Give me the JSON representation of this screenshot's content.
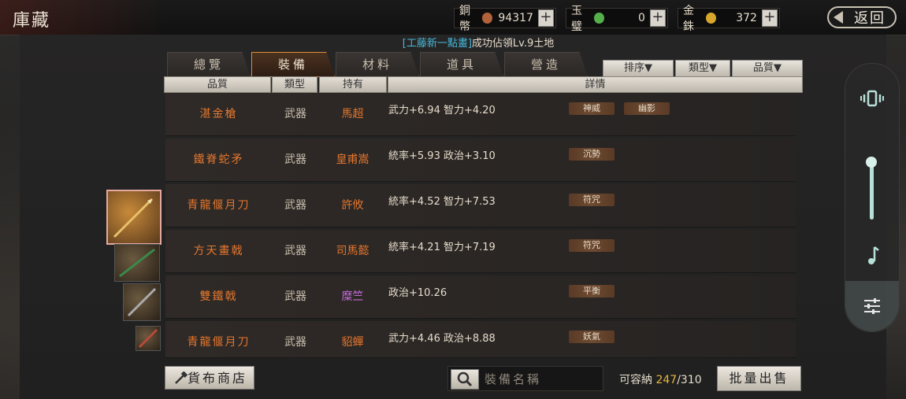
{
  "header": {
    "title": "庫藏",
    "return_label": "返回",
    "currencies": [
      {
        "label": "銅幣",
        "value": "94317",
        "color": "#b0623a"
      },
      {
        "label": "玉璧",
        "value": "0",
        "color": "#55b04a"
      },
      {
        "label": "金銖",
        "value": "372",
        "color": "#d6a72c"
      }
    ]
  },
  "notice": {
    "highlight": "[工藤新一點畫]",
    "text": "成功佔領Lv.9土地"
  },
  "tabs": [
    "總覽",
    "裝備",
    "材料",
    "道具",
    "營造"
  ],
  "active_tab": "裝備",
  "filters": [
    "排序▼",
    "類型▼",
    "品質▼"
  ],
  "table": {
    "headers": [
      "品質",
      "類型",
      "持有",
      "詳情"
    ],
    "rows": [
      {
        "name": "湛金槍",
        "type": "武器",
        "holder": "馬超",
        "stats": "武力+6.94 智力+4.20",
        "badges": [
          "神威",
          "幽影"
        ],
        "holder_color": "orange"
      },
      {
        "name": "鐵脊蛇矛",
        "type": "武器",
        "holder": "皇甫嵩",
        "stats": "統率+5.93 政治+3.10",
        "badges": [
          "沉勢"
        ],
        "holder_color": "orange"
      },
      {
        "name": "青龍偃月刀",
        "type": "武器",
        "holder": "許攸",
        "stats": "統率+4.52 智力+7.53",
        "badges": [
          "符咒"
        ],
        "holder_color": "orange"
      },
      {
        "name": "方天畫戟",
        "type": "武器",
        "holder": "司馬懿",
        "stats": "統率+4.21 智力+7.19",
        "badges": [
          "符咒"
        ],
        "holder_color": "orange"
      },
      {
        "name": "雙鐵戟",
        "type": "武器",
        "holder": "糜竺",
        "stats": "政治+10.26",
        "badges": [
          "平衡"
        ],
        "holder_color": "purple"
      },
      {
        "name": "青龍偃月刀",
        "type": "武器",
        "holder": "貂蟬",
        "stats": "武力+4.46 政治+8.88",
        "badges": [
          "妖氣"
        ],
        "holder_color": "orange"
      }
    ]
  },
  "footer": {
    "shop_label": "貨布商店",
    "search_placeholder": "裝備名稱",
    "capacity_label": "可容納",
    "capacity_used": "247",
    "capacity_total": "/310",
    "sell_label": "批量出售"
  }
}
